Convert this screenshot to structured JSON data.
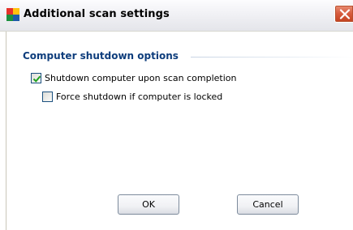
{
  "window": {
    "title": "Additional scan settings",
    "icon": "avg-logo-icon",
    "close_icon": "close-icon"
  },
  "section": {
    "title": "Computer shutdown options"
  },
  "options": [
    {
      "label": "Shutdown computer upon scan completion",
      "checked": true
    },
    {
      "label": "Force shutdown if computer is locked",
      "checked": false
    }
  ],
  "buttons": {
    "ok_label": "OK",
    "cancel_label": "Cancel"
  },
  "colors": {
    "section_title": "#0e3d7c",
    "checkmark": "#21a121",
    "close_button": "#d65a3c"
  }
}
